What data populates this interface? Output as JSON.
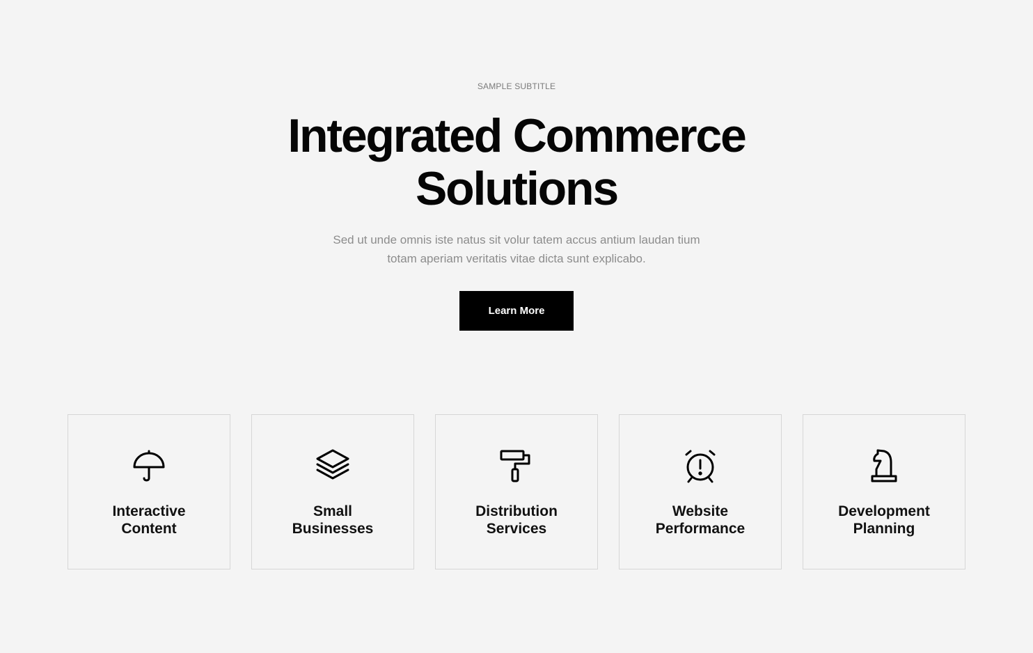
{
  "hero": {
    "subtitle": "SAMPLE SUBTITLE",
    "title_line1": "Integrated Commerce",
    "title_line2": "Solutions",
    "description_line1": "Sed ut unde omnis iste natus sit volur tatem accus antium laudan tium",
    "description_line2": "totam aperiam veritatis vitae dicta sunt explicabo.",
    "cta_label": "Learn More"
  },
  "features": [
    {
      "icon": "umbrella-icon",
      "line1": "Interactive",
      "line2": "Content"
    },
    {
      "icon": "layers-icon",
      "line1": "Small",
      "line2": "Businesses"
    },
    {
      "icon": "paint-roller-icon",
      "line1": "Distribution",
      "line2": "Services"
    },
    {
      "icon": "alarm-clock-icon",
      "line1": "Website",
      "line2": "Performance"
    },
    {
      "icon": "chess-knight-icon",
      "line1": "Development",
      "line2": "Planning"
    }
  ],
  "colors": {
    "background": "#f4f4f4",
    "primary": "#000000",
    "muted_text": "#8c8c8c",
    "card_border": "#d6d6d6"
  }
}
